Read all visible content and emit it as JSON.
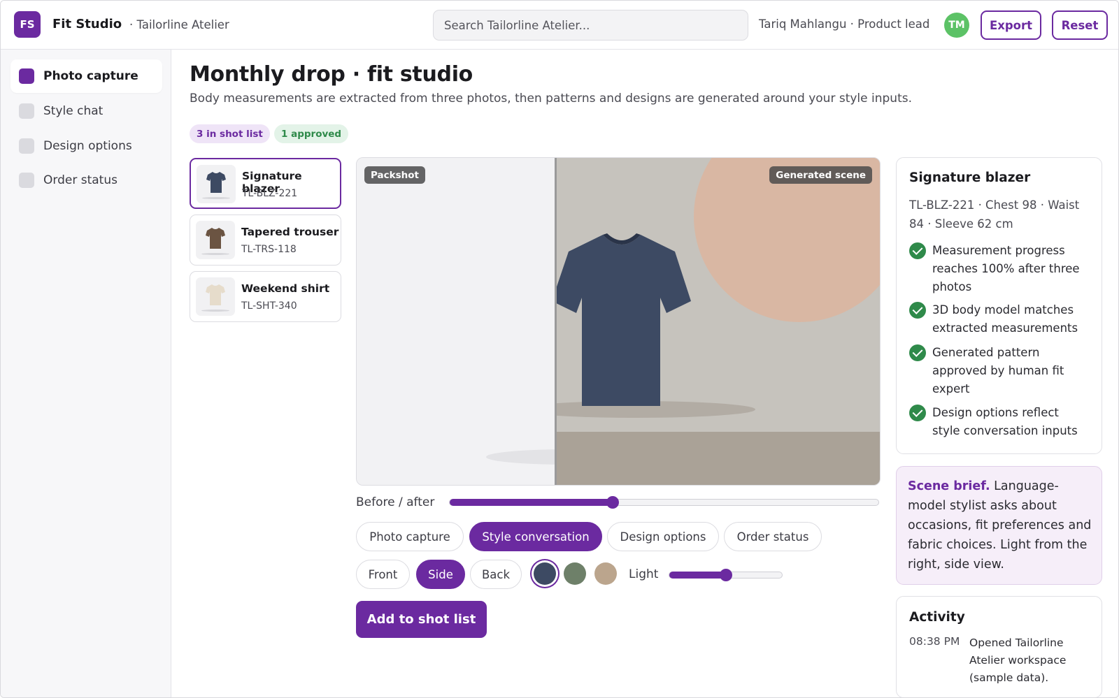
{
  "header": {
    "logo_initials": "FS",
    "app_name": "Fit Studio",
    "workspace": "· Tailorline Atelier",
    "search_placeholder": "Search Tailorline Atelier...",
    "user": "Tariq Mahlangu · Product lead",
    "avatar_initials": "TM",
    "export_label": "Export",
    "reset_label": "Reset"
  },
  "sidebar": {
    "items": [
      {
        "label": "Photo capture",
        "active": true
      },
      {
        "label": "Style chat",
        "active": false
      },
      {
        "label": "Design options",
        "active": false
      },
      {
        "label": "Order status",
        "active": false
      }
    ]
  },
  "main": {
    "title": "Monthly drop · fit studio",
    "subtitle": "Body measurements are extracted from three photos, then patterns and designs are generated around your style inputs.",
    "badges": {
      "shot_list": "3 in shot list",
      "approved": "1 approved"
    }
  },
  "products": [
    {
      "name": "Signature blazer",
      "sku": "TL-BLZ-221",
      "color": "#3d4a63",
      "active": true
    },
    {
      "name": "Tapered trouser",
      "sku": "TL-TRS-118",
      "color": "#6b5442",
      "active": false
    },
    {
      "name": "Weekend shirt",
      "sku": "TL-SHT-340",
      "color": "#e6dccb",
      "active": false
    }
  ],
  "stage": {
    "before_label": "Packshot",
    "after_label": "Generated scene",
    "garment_color": "#3d4a63"
  },
  "controls": {
    "before_after_label": "Before / after",
    "before_after_value": 0.38,
    "stage_tabs": [
      {
        "label": "Photo capture",
        "active": false
      },
      {
        "label": "Style conversation",
        "active": true
      },
      {
        "label": "Design options",
        "active": false
      },
      {
        "label": "Order status",
        "active": false
      }
    ],
    "views": [
      {
        "label": "Front",
        "active": false
      },
      {
        "label": "Side",
        "active": true
      },
      {
        "label": "Back",
        "active": false
      }
    ],
    "swatches": [
      {
        "color": "#3d4a63",
        "selected": true
      },
      {
        "color": "#6e8069",
        "selected": false
      },
      {
        "color": "#bba58d",
        "selected": false
      }
    ],
    "light_label": "Light",
    "light_value": 0.5,
    "add_button": "Add to shot list"
  },
  "detail": {
    "title": "Signature blazer",
    "meta": "TL-BLZ-221 · Chest 98 · Waist 84 · Sleeve 62 cm",
    "checks": [
      "Measurement progress reaches 100% after three photos",
      "3D body model matches extracted measurements",
      "Generated pattern approved by human fit expert",
      "Design options reflect style conversation inputs"
    ]
  },
  "brief": {
    "lead": "Scene brief.",
    "text": " Language-model stylist asks about occasions, fit preferences and fabric choices. Light from the right, side view."
  },
  "activity": {
    "title": "Activity",
    "entries": [
      {
        "time": "08:38 PM",
        "text": "Opened Tailorline Atelier workspace (sample data)."
      }
    ]
  },
  "colors": {
    "accent": "#6b2aa0",
    "success": "#2f8a4a"
  }
}
